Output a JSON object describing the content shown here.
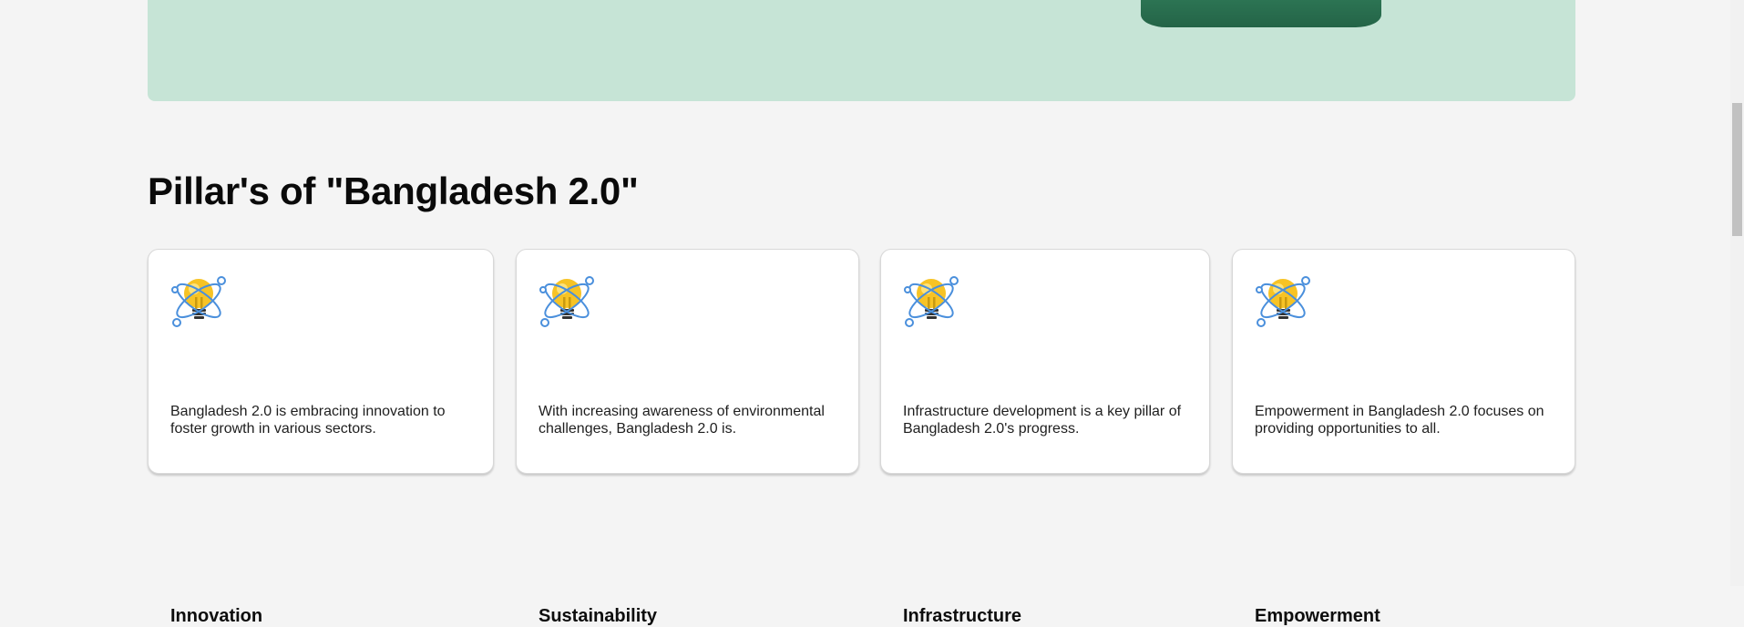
{
  "section": {
    "title": "Pillar's of \"Bangladesh 2.0\""
  },
  "pillars": [
    {
      "title": "Innovation",
      "description": "Bangladesh 2.0 is embracing innovation to foster growth in various sectors.",
      "icon": "lightbulb-atom-icon"
    },
    {
      "title": "Sustainability",
      "description": "With increasing awareness of environmental challenges, Bangladesh 2.0 is.",
      "icon": "lightbulb-atom-icon"
    },
    {
      "title": "Infrastructure",
      "description": "Infrastructure development is a key pillar of Bangladesh 2.0's progress.",
      "icon": "lightbulb-atom-icon"
    },
    {
      "title": "Empowerment",
      "description": "Empowerment in Bangladesh 2.0 focuses on providing opportunities to all.",
      "icon": "lightbulb-atom-icon"
    }
  ],
  "colors": {
    "hero_bg": "#c6e4d6",
    "flag_green": "#2f7a58",
    "flag_red": "#ee0000",
    "page_bg": "#f4f4f4"
  }
}
